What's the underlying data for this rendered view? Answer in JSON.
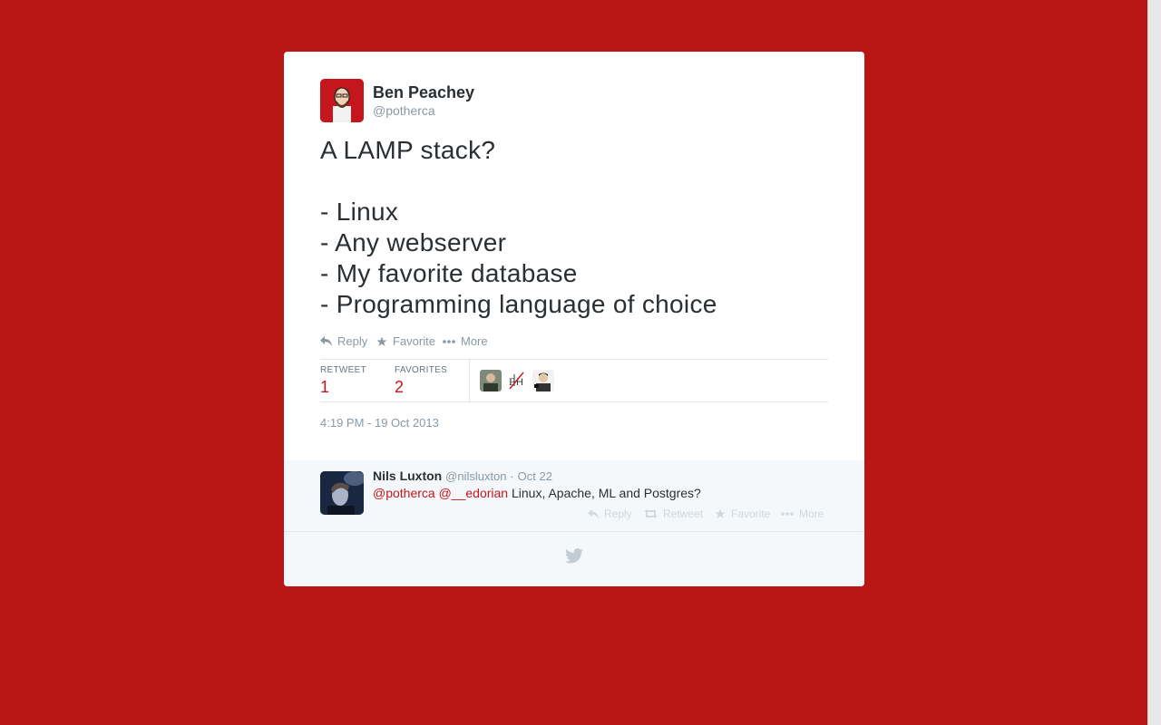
{
  "tweet": {
    "author_name": "Ben Peachey",
    "author_handle": "@potherca",
    "lines": [
      "A LAMP stack?",
      "",
      "- Linux",
      "- Any webserver",
      "- My favorite database",
      "- Programming language of choice"
    ],
    "actions": {
      "reply_label": "Reply",
      "favorite_label": "Favorite",
      "more_label": "More"
    },
    "stats": {
      "retweet_label": "RETWEET",
      "retweet_count": "1",
      "favorites_label": "FAVORITES",
      "favorites_count": "2"
    },
    "timestamp": "4:19 PM - 19 Oct 2013"
  },
  "reply": {
    "author_name": "Nils Luxton",
    "author_handle": "@nilsluxton",
    "separator": "·",
    "date": "Oct 22",
    "mention_1": "@potherca",
    "mention_2": "@__edorian",
    "text": "Linux, Apache, ML and Postgres?",
    "actions": {
      "reply_label": "Reply",
      "retweet_label": "Retweet",
      "favorite_label": "Favorite",
      "more_label": "More"
    }
  },
  "colors": {
    "background": "#bb1616",
    "accent": "#c4161c",
    "muted": "#8899a6"
  }
}
